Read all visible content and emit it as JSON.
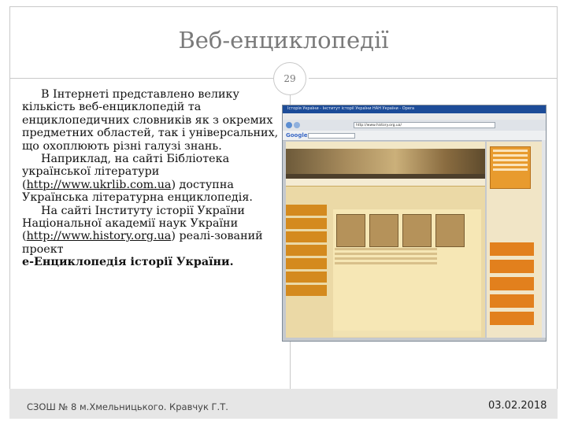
{
  "slide": {
    "title": "Веб-енциклопедії",
    "page_number": "29",
    "paragraph1": "В Інтернеті представлено велику кількість веб-енциклопедій та енциклопедичних словників як з окремих предметних областей, так і універсальних, що охоплюють різні галузі знань.",
    "paragraph2_prefix": "Наприклад, на сайті Бібліотека української літератури (",
    "paragraph2_link": "http://www.ukrlib.com.ua",
    "paragraph2_suffix": ") доступна Українська літературна енциклопедія.",
    "paragraph3_prefix": "На сайті Інституту історії України Національної академії наук України (",
    "paragraph3_link": "http://www.history.org.ua",
    "paragraph3_suffix": ") реалі-зований проект",
    "paragraph3_bold": "е-Енциклопедія історії України.",
    "footer_left": "СЗОШ № 8 м.Хмельницького. Кравчук Г.Т.",
    "footer_date": "03.02.2018"
  },
  "screenshot": {
    "window_title": "Історія України - Інститут історії України НАН України - Opera",
    "address": "http://www.history.org.ua/",
    "google_label": "Google",
    "site_banner_text": "ІНСТИТУТ ІСТОРІЇ УКРАЇНИ НАЦІОНАЛЬНОЇ АКАДЕМІЇ НАУК УКРАЇНИ"
  }
}
